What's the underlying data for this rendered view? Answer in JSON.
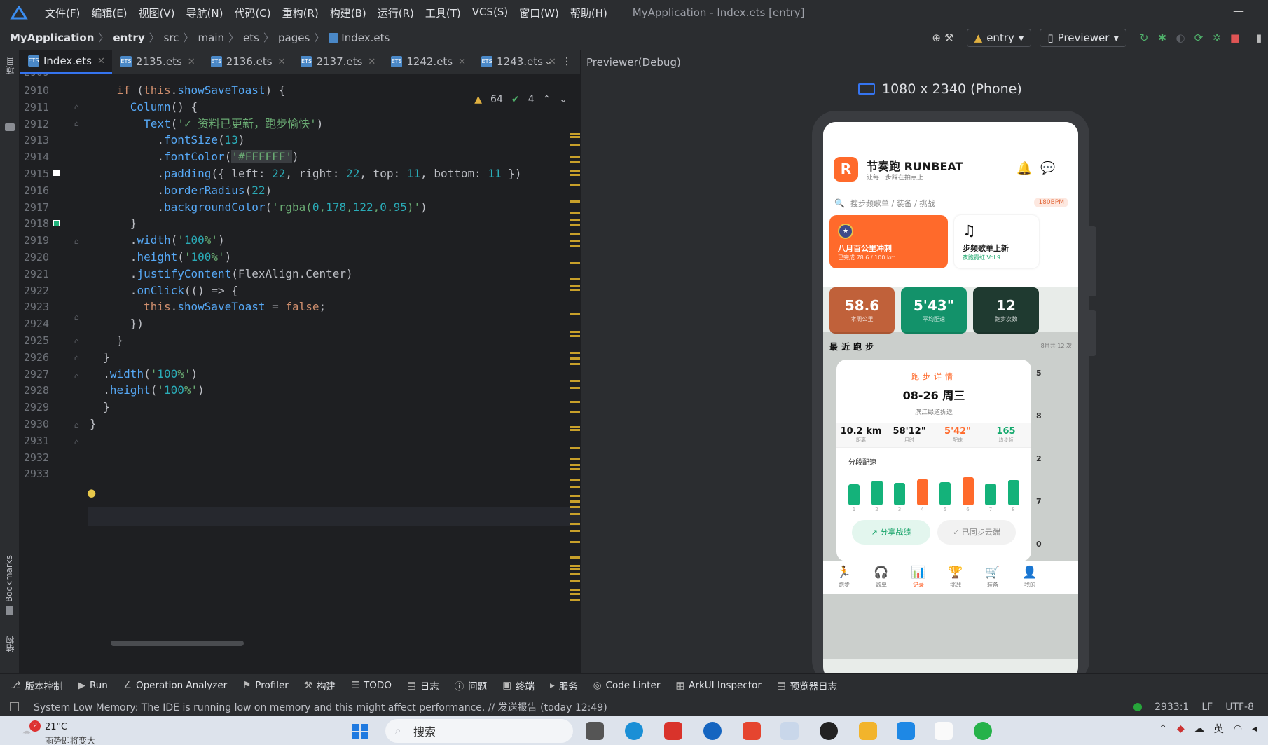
{
  "menu": {
    "items": [
      "文件(F)",
      "编辑(E)",
      "视图(V)",
      "导航(N)",
      "代码(C)",
      "重构(R)",
      "构建(B)",
      "运行(R)",
      "工具(T)",
      "VCS(S)",
      "窗口(W)",
      "帮助(H)"
    ],
    "window_title": "MyApplication - Index.ets [entry]"
  },
  "breadcrumb": {
    "project": "MyApplication",
    "module": "entry",
    "parts": [
      "src",
      "main",
      "ets",
      "pages"
    ],
    "file": "Index.ets"
  },
  "toolbar": {
    "module_select": "entry",
    "previewer_select": "Previewer"
  },
  "side": {
    "project_label": "项目",
    "bookmarks_label": "Bookmarks",
    "structure_label": "结构"
  },
  "tabs": [
    {
      "label": "Index.ets",
      "active": true
    },
    {
      "label": "2135.ets"
    },
    {
      "label": "2136.ets"
    },
    {
      "label": "2137.ets"
    },
    {
      "label": "1242.ets"
    },
    {
      "label": "1243.ets"
    }
  ],
  "inspection": {
    "warnings": "64",
    "checks": "4"
  },
  "code": {
    "first_line_partial": "2909",
    "lines": [
      {
        "n": "2910",
        "text": "    if (this.showSaveToast) {"
      },
      {
        "n": "2911",
        "text": "      Column() {"
      },
      {
        "n": "2912",
        "text": "        Text('✓ 资料已更新，跑步愉快')"
      },
      {
        "n": "2913",
        "text": "          .fontSize(13)"
      },
      {
        "n": "2914",
        "text": "          .fontColor('#FFFFFF')"
      },
      {
        "n": "2915",
        "text": "          .padding({ left: 22, right: 22, top: 11, bottom: 11 })"
      },
      {
        "n": "2916",
        "text": "          .borderRadius(22)"
      },
      {
        "n": "2917",
        "text": "          .backgroundColor('rgba(0,178,122,0.95)')"
      },
      {
        "n": "2918",
        "text": "      }"
      },
      {
        "n": "2919",
        "text": "      .width('100%')"
      },
      {
        "n": "2920",
        "text": "      .height('100%')"
      },
      {
        "n": "2921",
        "text": "      .justifyContent(FlexAlign.Center)"
      },
      {
        "n": "2922",
        "text": "      .onClick(() => {"
      },
      {
        "n": "2923",
        "text": "        this.showSaveToast = false;"
      },
      {
        "n": "2924",
        "text": "      })"
      },
      {
        "n": "2925",
        "text": "    }"
      },
      {
        "n": "2926",
        "text": "  }"
      },
      {
        "n": "2927",
        "text": "  .width('100%')"
      },
      {
        "n": "2928",
        "text": "  .height('100%')"
      },
      {
        "n": "2929",
        "text": "  }"
      },
      {
        "n": "2930",
        "text": "}"
      },
      {
        "n": "2931",
        "text": ""
      },
      {
        "n": "2932",
        "text": ""
      },
      {
        "n": "2933",
        "text": ""
      }
    ]
  },
  "previewer": {
    "title": "Previewer(Debug)",
    "resolution": "1080 x 2340 (Phone)"
  },
  "app": {
    "avatar_letter": "R",
    "name": "节奏跑 RUNBEAT",
    "slogan": "让每一步踩在拍点上",
    "search_placeholder": "搜步频歌单 / 装备 / 挑战",
    "bpm_tag": "180BPM",
    "banner1": {
      "title": "八月百公里冲刺",
      "sub": "已完成 78.6 / 100 km"
    },
    "banner2": {
      "title": "步频歌单上新",
      "sub": "夜跑霓虹 Vol.9"
    },
    "stats": [
      {
        "value": "58.6",
        "label": "本周公里",
        "color": "#c0613a"
      },
      {
        "value": "5'43\"",
        "label": "平均配速",
        "color": "#13926a"
      },
      {
        "value": "12",
        "label": "跑步次数",
        "color": "#1f3a30"
      }
    ],
    "recent_title": "最近跑步",
    "recent_meta": "8月共 12 次",
    "detail": {
      "header": "跑步详情",
      "date": "08-26 周三",
      "route": "滨江绿道折返",
      "metrics": [
        {
          "value": "10.2 km",
          "label": "距离",
          "color": "#111111"
        },
        {
          "value": "58'12\"",
          "label": "用时",
          "color": "#111111"
        },
        {
          "value": "5'42\"",
          "label": "配速",
          "color": "#ff6a2b"
        },
        {
          "value": "165",
          "label": "均步频",
          "color": "#13a86c"
        }
      ],
      "segments_title": "分段配速",
      "segments": [
        {
          "label": "1",
          "level": 0.68,
          "color": "#14b27a"
        },
        {
          "label": "2",
          "level": 0.8,
          "color": "#14b27a"
        },
        {
          "label": "3",
          "level": 0.72,
          "color": "#14b27a"
        },
        {
          "label": "4",
          "level": 0.85,
          "color": "#ff6a2b"
        },
        {
          "label": "5",
          "level": 0.76,
          "color": "#14b27a"
        },
        {
          "label": "6",
          "level": 0.9,
          "color": "#ff6a2b"
        },
        {
          "label": "7",
          "level": 0.7,
          "color": "#14b27a"
        },
        {
          "label": "8",
          "level": 0.82,
          "color": "#14b27a"
        }
      ],
      "share_button": "↗ 分享战绩",
      "synced_button": "✓ 已同步云端"
    },
    "peek_numbers": [
      "5",
      "8",
      "2",
      "7",
      "0"
    ],
    "tabbar": [
      {
        "icon": "🏃",
        "label": "跑步"
      },
      {
        "icon": "🎧",
        "label": "歌单"
      },
      {
        "icon": "📊",
        "label": "记录",
        "active": true
      },
      {
        "icon": "🏆",
        "label": "挑战"
      },
      {
        "icon": "🛒",
        "label": "装备"
      },
      {
        "icon": "👤",
        "label": "我的"
      }
    ]
  },
  "bottom_tools": [
    "版本控制",
    "Run",
    "Operation Analyzer",
    "Profiler",
    "构建",
    "TODO",
    "日志",
    "问题",
    "终端",
    "服务",
    "Code Linter",
    "ArkUI Inspector",
    "预览器日志"
  ],
  "status": {
    "message": "System Low Memory: The IDE is running low on memory and this might affect performance. // 发送报告 (today 12:49)",
    "position": "2933:1",
    "line_sep": "LF",
    "encoding": "UTF-8"
  },
  "taskbar": {
    "weather_temp": "21°C",
    "weather_desc": "雨势即将变大",
    "weather_badge": "2",
    "search_label": "搜索",
    "ime": "英"
  }
}
